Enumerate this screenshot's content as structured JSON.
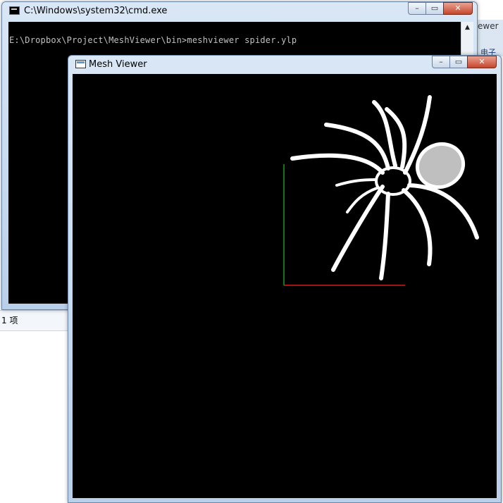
{
  "background": {
    "status_text": "1 项",
    "right_window_title": "ewer",
    "right_window_sub": "电子邮"
  },
  "cmd_window": {
    "title": "C:\\Windows\\system32\\cmd.exe",
    "console_line": "E:\\Dropbox\\Project\\MeshViewer\\bin>meshviewer spider.ylp",
    "controls": {
      "minimize": "–",
      "maximize": "▭",
      "close": "✕"
    },
    "scroll_up": "▲"
  },
  "mesh_window": {
    "title": "Mesh Viewer",
    "controls": {
      "minimize": "–",
      "maximize": "▭",
      "close": "✕"
    },
    "viewport": {
      "background": "#000000",
      "model_color": "#ffffff",
      "x_axis_color": "#ff2020",
      "y_axis_color": "#20c020"
    }
  }
}
